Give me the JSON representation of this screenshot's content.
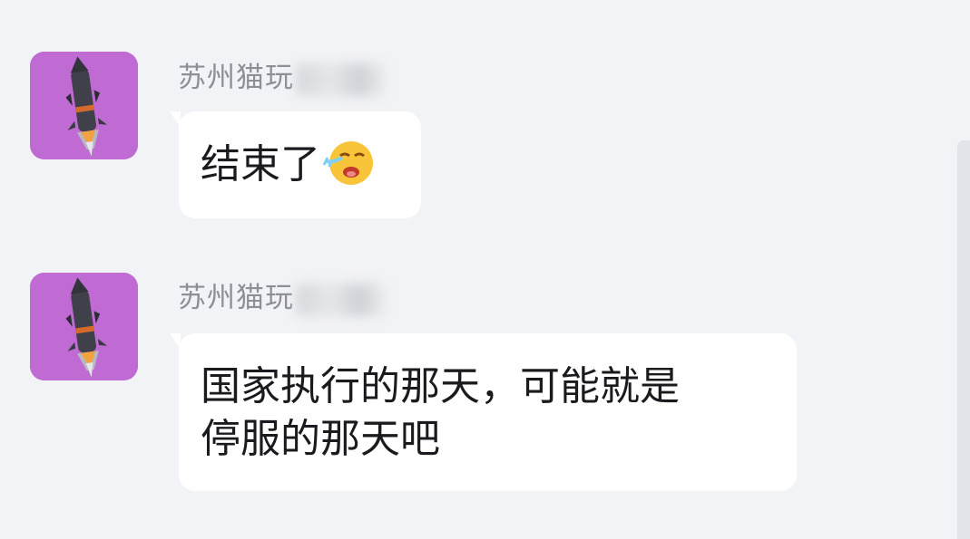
{
  "messages": [
    {
      "sender": "苏州猫玩",
      "text": "结束了",
      "emoji": "loudly-crying-face-icon"
    },
    {
      "sender": "苏州猫玩",
      "text_line1": "国家执行的那天，可能就是",
      "text_line2": "停服的那天吧"
    }
  ],
  "colors": {
    "background": "#f2f3f7",
    "bubble": "#ffffff",
    "avatar_bg": "#c06ad4",
    "sender_text": "#8e8f96"
  }
}
